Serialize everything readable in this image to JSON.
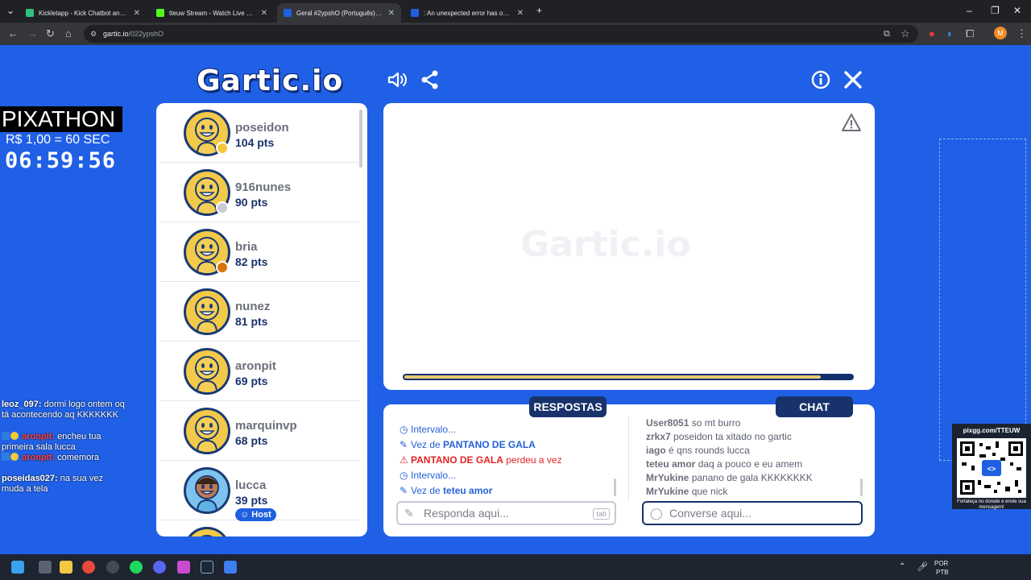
{
  "browser": {
    "tabs": [
      {
        "title": "Kickletapp - Kick Chatbot and ...",
        "color": "#2ec27e",
        "active": false
      },
      {
        "title": "tteuw Stream - Watch Live on K...",
        "color": "#53fc18",
        "active": false
      },
      {
        "title": "Geral #2ypshO (Português) - G...",
        "color": "#1f5fe0",
        "active": true
      },
      {
        "title": ": An unexpected error has occu...",
        "color": "#1f5fe0",
        "active": false
      }
    ],
    "url_host": "gartic.io",
    "url_path": "/022ypshO",
    "profile_initial": "M"
  },
  "game": {
    "logo": "Gartic.io",
    "watermark": "Gartic.io",
    "players": [
      {
        "name": "poseidon",
        "points": "104 pts",
        "medal": "#f3c93b"
      },
      {
        "name": "916nunes",
        "points": "90 pts",
        "medal": "#c9ccd3"
      },
      {
        "name": "bria",
        "points": "82 pts",
        "medal": "#d9730d"
      },
      {
        "name": "nunez",
        "points": "81 pts",
        "medal": ""
      },
      {
        "name": "aronpit",
        "points": "69 pts",
        "medal": ""
      },
      {
        "name": "marquinvp",
        "points": "68 pts",
        "medal": ""
      },
      {
        "name": "lucca",
        "points": "39 pts",
        "medal": "",
        "badge": "Host"
      }
    ],
    "timer_fraction": 0.93,
    "answers_tab": "RESPOSTAS",
    "chat_tab": "CHAT",
    "answers": [
      {
        "icon": "clock",
        "text": "Intervalo..."
      },
      {
        "icon": "pencil",
        "prefix": "Vez de ",
        "bold": "PANTANO DE GALA"
      },
      {
        "icon": "warning",
        "bold": "PANTANO DE GALA",
        "suffix": " perdeu a vez"
      },
      {
        "icon": "clock",
        "text": "Intervalo..."
      },
      {
        "icon": "pencil",
        "prefix": "Vez de ",
        "bold": "teteu amor"
      }
    ],
    "chat": [
      {
        "user": "User8051",
        "msg": "so mt burro"
      },
      {
        "user": "zrkx7",
        "msg": "poseidon ta xitado no gartic"
      },
      {
        "user": "iago",
        "msg": "é qns rounds lucca"
      },
      {
        "user": "teteu amor",
        "msg": "daq a pouco e eu amem"
      },
      {
        "user": "MrYukine",
        "msg": "panano de gala KKKKKKKK"
      },
      {
        "user": "MrYukine",
        "msg": "que nick"
      }
    ],
    "answer_placeholder": "Responda aqui...",
    "tab_key": "tab",
    "chat_placeholder": "Converse aqui..."
  },
  "overlay": {
    "pix_title": "PIXATHON",
    "pix_rate": "R$ 1,00 = 60 SEC",
    "pix_timer": "06:59:56",
    "stream_chat": [
      {
        "user": "leoz_097:",
        "msg": " dormi logo ontem oq tá acontecendo aq KKKKKKK"
      },
      {
        "user": "aronpit:",
        "msg": " encheu tua primeira sala lucca",
        "badge": true
      },
      {
        "user": "aronpit:",
        "msg": " comemora",
        "badge": true
      },
      {
        "user": "poseidas027:",
        "msg": " na sua vez muda a tela"
      }
    ],
    "qr_title": "pixgg.com/TTEUW",
    "qr_note": "Fortaleça no donate e envie sua mensagem!"
  },
  "taskbar": {
    "lang": "POR",
    "layout": "PTB"
  }
}
